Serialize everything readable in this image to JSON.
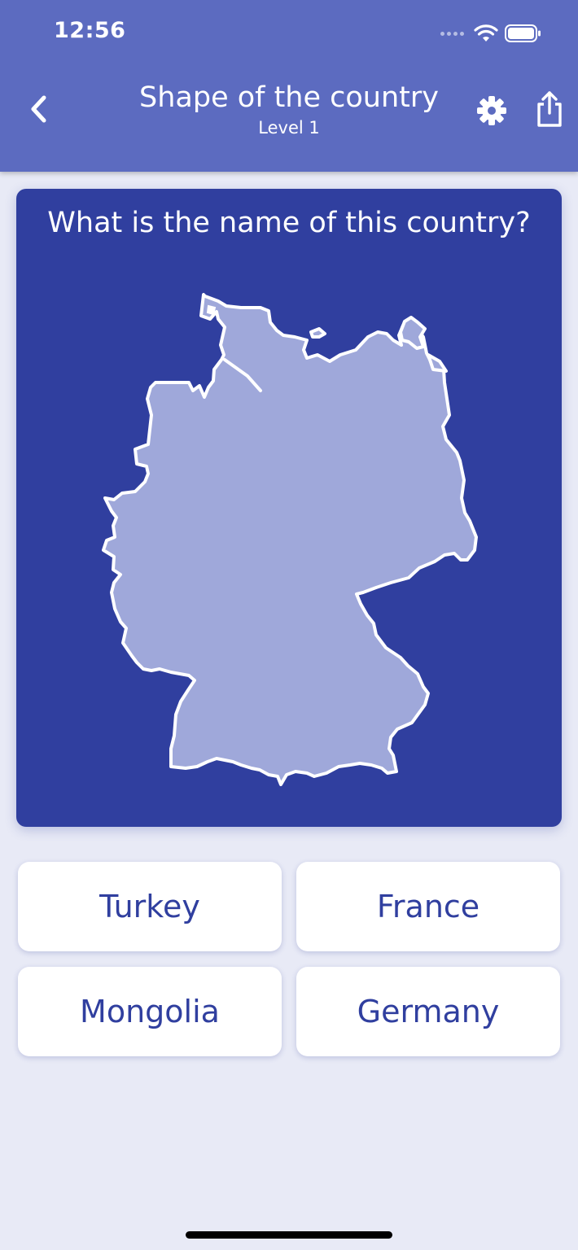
{
  "status_bar": {
    "time": "12:56",
    "icons": [
      "cellular-signal-icon",
      "wifi-icon",
      "battery-icon"
    ]
  },
  "header": {
    "title": "Shape of the country",
    "subtitle": "Level 1",
    "back_icon": "chevron-left-icon",
    "settings_icon": "gear-icon",
    "share_icon": "share-icon"
  },
  "question": {
    "text": "What is the name of this country?",
    "map_subject": "country-outline-germany"
  },
  "answers": [
    {
      "label": "Turkey"
    },
    {
      "label": "France"
    },
    {
      "label": "Mongolia"
    },
    {
      "label": "Germany"
    }
  ],
  "colors": {
    "header_bg": "#5c6bc0",
    "card_bg": "#303f9f",
    "map_fill": "#9fa8da",
    "map_stroke": "#ffffff",
    "answer_text": "#303f9f",
    "page_bg": "#e8eaf6"
  }
}
